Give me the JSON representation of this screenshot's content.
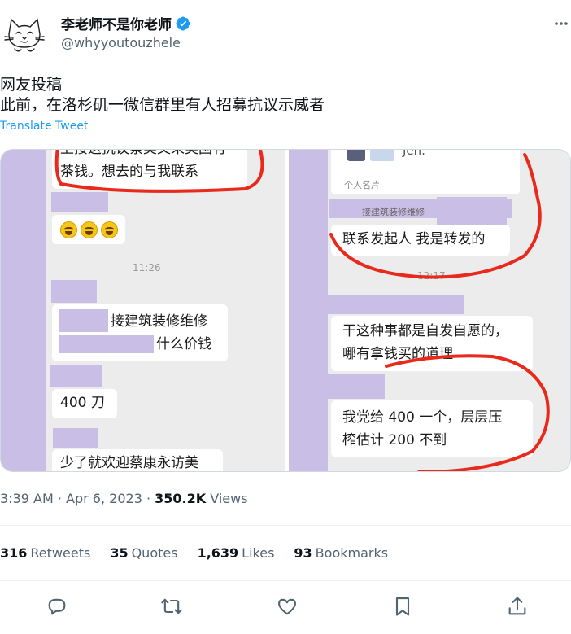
{
  "author": {
    "display_name": "李老师不是你老师",
    "handle": "@whyyoutouzhele",
    "verified_color": "#1d9bf0"
  },
  "tweet": {
    "text_line1": "网友投稿",
    "text_line2": "此前，在洛杉矶一微信群里有人招募抗议示威者",
    "translate_label": "Translate Tweet"
  },
  "media": {
    "left": {
      "msg_top_cut": "上接这抗议蔡美文来美国有",
      "msg_top": "茶钱。想去的与我联系",
      "time": "11:26",
      "msg_ad_line1": "接建筑装修维修",
      "msg_ad_line2": "什么价钱",
      "msg_price": "400 刀",
      "msg_last": "少了就欢迎蔡康永访美"
    },
    "right": {
      "card_partial": "Jen.",
      "card_label": "个人名片",
      "ad_text": "接建筑装修维修",
      "msg_1": "联系发起人 我是转发的",
      "time_partial": "12:17",
      "msg_2_line1": "干这种事都是自发自愿的，",
      "msg_2_line2": "哪有拿钱买的道理",
      "msg_3_line1": "我党给 400 一个，层层压",
      "msg_3_line2": "榨估计 200 不到"
    },
    "highlight_color": "#c9bee6",
    "annotation_color": "#e8291c"
  },
  "meta": {
    "time": "3:39 AM",
    "sep1": " · ",
    "date": "Apr 6, 2023",
    "sep2": " · ",
    "views_count": "350.2K",
    "views_label": "Views"
  },
  "stats": [
    {
      "count": "316",
      "label": "Retweets"
    },
    {
      "count": "35",
      "label": "Quotes"
    },
    {
      "count": "1,639",
      "label": "Likes"
    },
    {
      "count": "93",
      "label": "Bookmarks"
    }
  ],
  "actions": [
    "reply-icon",
    "retweet-icon",
    "like-icon",
    "bookmark-icon",
    "share-icon"
  ]
}
